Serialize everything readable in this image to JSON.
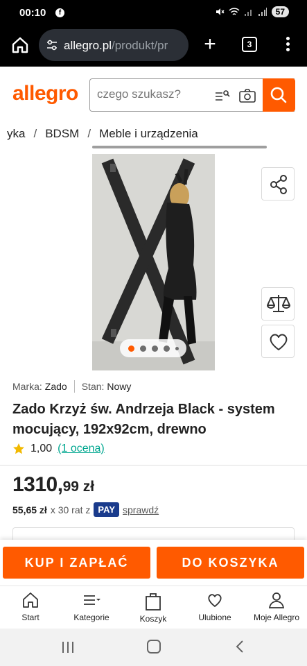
{
  "status_bar": {
    "time": "00:10",
    "facebook_glyph": "f",
    "battery": "57",
    "icons": [
      "mute-icon",
      "wifi-icon",
      "signal-icon",
      "signal-icon"
    ]
  },
  "browser": {
    "url_domain": "allegro.pl",
    "url_path": "/produkt/pr",
    "tab_count": "3"
  },
  "header": {
    "logo": "allegro",
    "search_placeholder": "czego szukasz?"
  },
  "breadcrumb": {
    "items": [
      "yka",
      "BDSM",
      "Meble i urządzenia"
    ],
    "separator": "/"
  },
  "gallery": {
    "dots": 5,
    "active_dot": 0
  },
  "product": {
    "brand_label": "Marka:",
    "brand_value": "Zado",
    "condition_label": "Stan:",
    "condition_value": "Nowy",
    "title": "Zado Krzyż św. Andrzeja Black - system mocujący, 192x92cm, drewno",
    "rating_value": "1,00",
    "rating_link": "(1 ocena)",
    "price_main": "1310,",
    "price_fraction": "99 zł",
    "installment_amount": "55,65 zł",
    "installment_text": "x 30 rat z",
    "pay_badge": "PAY",
    "installment_link": "sprawdź"
  },
  "actions": {
    "buy_label": "KUP I ZAPŁAĆ",
    "cart_label": "DO KOSZYKA"
  },
  "bottom_nav": {
    "items": [
      "Start",
      "Kategorie",
      "Koszyk",
      "Ulubione",
      "Moje Allegro"
    ]
  },
  "colors": {
    "brand": "#ff5a00",
    "link": "#00a790",
    "pay_badge": "#1a3b8c"
  }
}
